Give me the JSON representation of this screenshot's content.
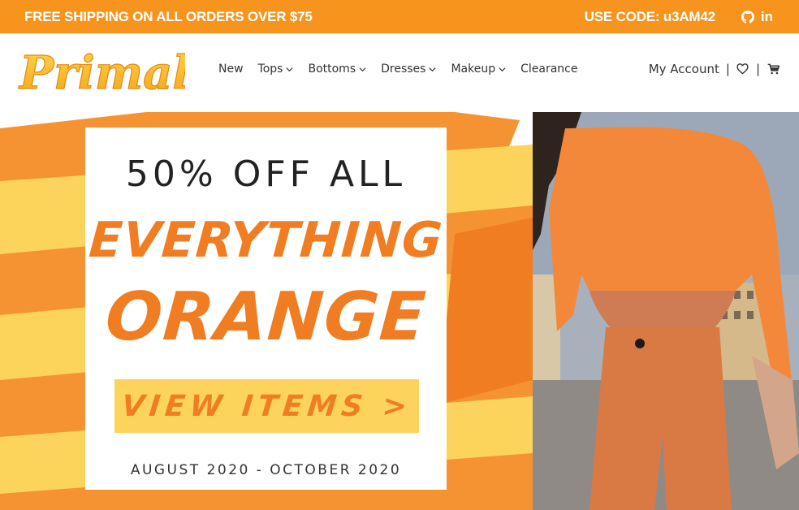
{
  "topbar": {
    "shipping_text": "FREE SHIPPING ON ALL ORDERS OVER $75",
    "code_text": "USE CODE: u3AM42",
    "social": [
      "github-icon",
      "linkedin-icon"
    ],
    "linkedin_label": "in",
    "bg_color": "#f7941d"
  },
  "header": {
    "logo_text": "Primal",
    "nav": [
      {
        "label": "New",
        "has_dropdown": false
      },
      {
        "label": "Tops",
        "has_dropdown": true
      },
      {
        "label": "Bottoms",
        "has_dropdown": true
      },
      {
        "label": "Dresses",
        "has_dropdown": true
      },
      {
        "label": "Makeup",
        "has_dropdown": true
      },
      {
        "label": "Clearance",
        "has_dropdown": false
      }
    ],
    "account_label": "My Account",
    "account_icons": [
      "heart-icon",
      "cart-icon"
    ],
    "separator": "|"
  },
  "hero": {
    "headline": "50% OFF ALL",
    "line1": "EVERYTHING",
    "line2": "ORANGE",
    "cta_label": "VIEW ITEMS >",
    "dates": "AUGUST 2020 - OCTOBER 2020",
    "accent_color": "#f07d22",
    "cta_color": "#fcd45b"
  }
}
